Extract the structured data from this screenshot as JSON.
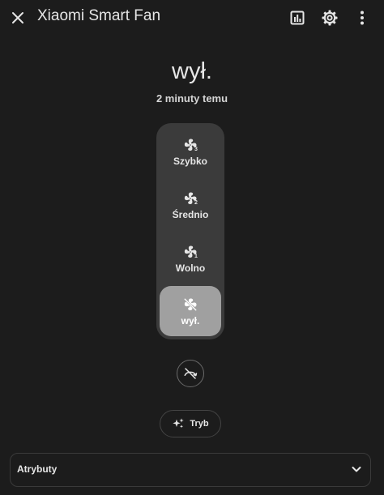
{
  "header": {
    "title": "Xiaomi Smart Fan",
    "close_icon": "close-icon",
    "history_icon": "chart-box-icon",
    "settings_icon": "gear-icon",
    "menu_icon": "dots-vertical-icon"
  },
  "state": {
    "value": "wył.",
    "last_changed": "2 minuty temu"
  },
  "speeds": [
    {
      "label": "Szybko",
      "level": "3",
      "active": false
    },
    {
      "label": "Średnio",
      "level": "2",
      "active": false
    },
    {
      "label": "Wolno",
      "level": "1",
      "active": false
    },
    {
      "label": "wył.",
      "level": "",
      "active": true
    }
  ],
  "oscillate": {
    "icon": "oscillation-off-icon"
  },
  "mode": {
    "label": "Tryb",
    "icon": "sparkles-icon"
  },
  "attributes": {
    "label": "Atrybuty",
    "icon": "chevron-down-icon"
  },
  "colors": {
    "background": "#1c1c1c",
    "control_track": "#3b3b3b",
    "active_segment": "#a0a0a0",
    "text": "#e6e6e6"
  }
}
